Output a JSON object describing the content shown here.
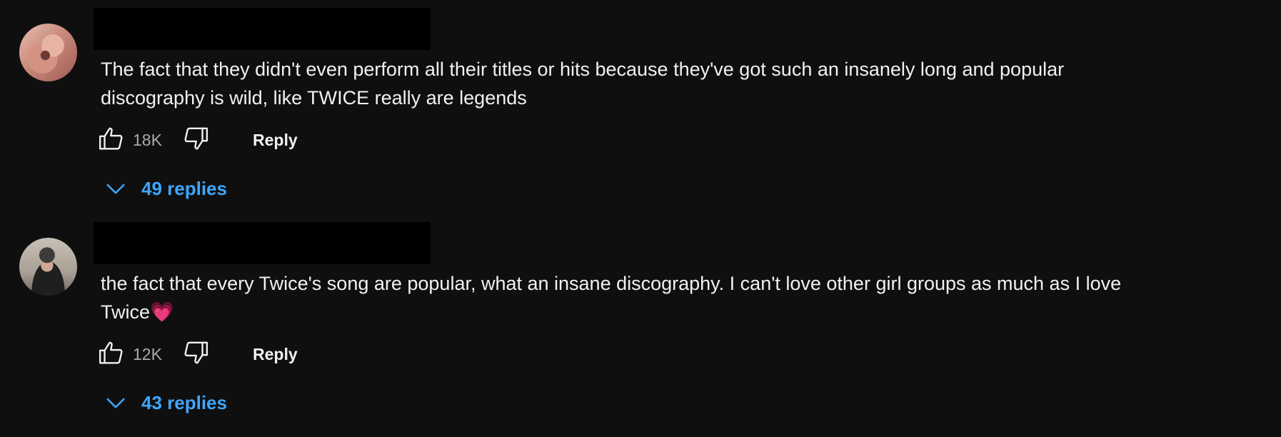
{
  "comments": [
    {
      "author_redacted": true,
      "text": "The fact that they didn't even perform all their titles or hits because they've got such an insanely long and popular discography is wild, like TWICE really are legends",
      "like_count": "18K",
      "reply_label": "Reply",
      "replies_label": "49 replies",
      "avatar_icon": "user-avatar"
    },
    {
      "author_redacted": true,
      "text": "the fact that every Twice's song are popular, what an insane discography. I can't love other girl groups as much as I love Twice",
      "text_emoji": "💗",
      "like_count": "12K",
      "reply_label": "Reply",
      "replies_label": "43 replies",
      "avatar_icon": "user-avatar"
    }
  ],
  "icons": {
    "like": "thumbs-up-icon",
    "dislike": "thumbs-down-icon",
    "expand": "chevron-down-icon"
  },
  "colors": {
    "background": "#0f0f0f",
    "text": "#f1f1f1",
    "secondary_text": "#aaaaaa",
    "link_blue": "#3ea6ff"
  }
}
